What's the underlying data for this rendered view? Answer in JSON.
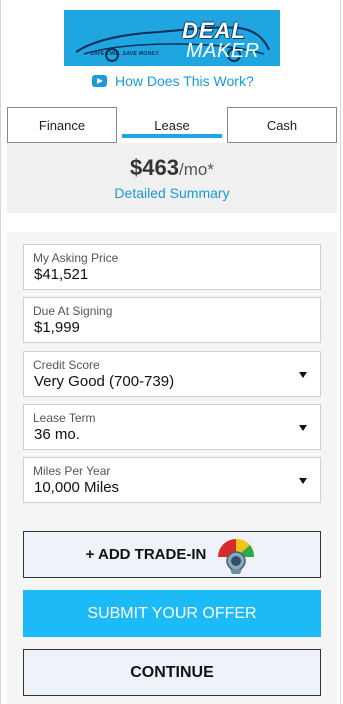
{
  "logo": {
    "word1": "DEAL",
    "word2": "MAKER",
    "tagline": "SAVE TIME. SAVE MONEY."
  },
  "how_link": {
    "label": "How Does This Work?",
    "icon": "play-icon"
  },
  "tabs": [
    {
      "label": "Finance",
      "active": false
    },
    {
      "label": "Lease",
      "active": true
    },
    {
      "label": "Cash",
      "active": false
    }
  ],
  "summary": {
    "price": "$463",
    "per": "/mo*",
    "link": "Detailed Summary"
  },
  "form": {
    "asking_price": {
      "label": "My Asking Price",
      "value": "$41,521"
    },
    "due_at_signing": {
      "label": "Due At Signing",
      "value": "$1,999"
    },
    "credit_score": {
      "label": "Credit Score",
      "value": "Very Good (700-739)"
    },
    "lease_term": {
      "label": "Lease Term",
      "value": "36 mo."
    },
    "miles_per_year": {
      "label": "Miles Per Year",
      "value": "10,000 Miles"
    }
  },
  "buttons": {
    "trade_in": "+ ADD TRADE-IN",
    "submit": "SUBMIT YOUR OFFER",
    "continue": "CONTINUE"
  },
  "colors": {
    "accent": "#1a9ad6",
    "submit_bg": "#1cbaf7",
    "tab_underline": "#1fa6e0"
  }
}
